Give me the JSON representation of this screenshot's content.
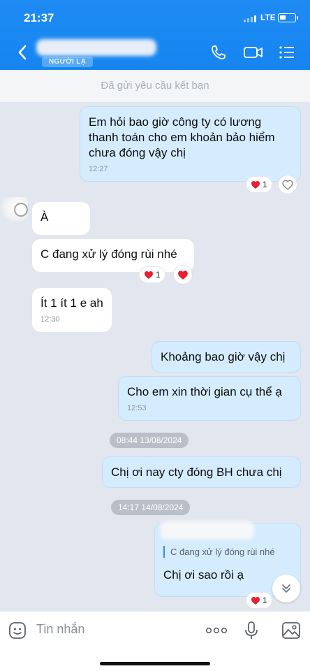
{
  "status_bar": {
    "time": "21:37",
    "network": "LTE"
  },
  "header": {
    "contact_badge": "NGƯỜI LẠ",
    "icons": [
      "back-icon",
      "phone-icon",
      "video-call-icon",
      "menu-icon"
    ]
  },
  "banner": {
    "text": "Đã gửi yêu cầu kết bạn"
  },
  "messages": [
    {
      "side": "mine",
      "text": "Em hỏi bao giờ công ty có lương thanh toán cho em khoản bảo hiểm chưa đóng vậy chị",
      "time": "12:27",
      "reaction_count": "1"
    },
    {
      "side": "theirs",
      "text": "À"
    },
    {
      "side": "theirs",
      "text": "C đang xử lý đóng rùi nhé",
      "reaction_count": "1"
    },
    {
      "side": "theirs",
      "text": "Ít 1 ít 1 e ah",
      "time": "12:30"
    },
    {
      "side": "mine",
      "text": "Khoảng bao giờ vậy chị"
    },
    {
      "side": "mine",
      "text": "Cho em xin thời gian cụ thể ạ",
      "time": "12:53"
    },
    {
      "side": "mine",
      "text": "Chị ơi nay cty đóng BH chưa chị"
    },
    {
      "side": "mine",
      "quote": "C đang xử lý đóng rùi nhé",
      "text": "Chị ơi sao rồi ạ",
      "reaction_count": "1"
    }
  ],
  "date_separators": [
    "08:44 13/08/2024",
    "14:17 14/08/2024"
  ],
  "input": {
    "placeholder": "Tin nhắn"
  },
  "colors": {
    "header_blue": "#1685f0",
    "my_bubble": "#d4ecfd",
    "their_bubble": "#ffffff",
    "heart": "#e8202f",
    "chat_bg": "#e2e6ee"
  }
}
